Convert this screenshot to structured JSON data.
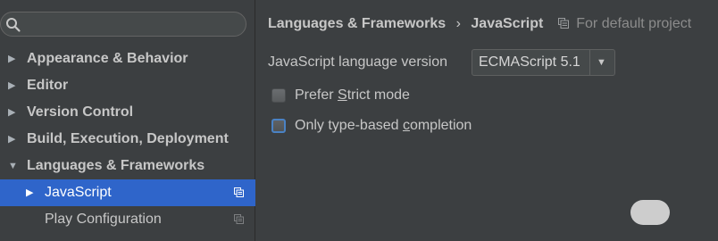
{
  "sidebar": {
    "search": {
      "value": "",
      "placeholder": ""
    },
    "items": [
      {
        "label": "Appearance & Behavior",
        "arrow": "▶"
      },
      {
        "label": "Editor",
        "arrow": "▶"
      },
      {
        "label": "Version Control",
        "arrow": "▶"
      },
      {
        "label": "Build, Execution, Deployment",
        "arrow": "▶"
      },
      {
        "label": "Languages & Frameworks",
        "arrow": "▼"
      },
      {
        "label": "JavaScript",
        "arrow": "▶"
      },
      {
        "label": "Play Configuration",
        "arrow": ""
      }
    ]
  },
  "main": {
    "breadcrumb": {
      "section": "Languages & Frameworks",
      "separator": "›",
      "page": "JavaScript"
    },
    "scope_note": "For default project",
    "language_version": {
      "label": "JavaScript language version",
      "value": "ECMAScript 5.1",
      "caret": "▼"
    },
    "prefer_strict": {
      "before": "Prefer ",
      "mnemonic": "S",
      "after": "trict mode",
      "checked": false
    },
    "type_based": {
      "before": "Only type-based ",
      "mnemonic": "c",
      "after": "ompletion",
      "checked": false
    }
  },
  "colors": {
    "selection": "#2f65ca",
    "focus_ring": "#4a82c4",
    "background": "#3c3f41"
  },
  "icons": [
    "search-icon",
    "copy-settings-icon",
    "chevron-down-icon"
  ]
}
